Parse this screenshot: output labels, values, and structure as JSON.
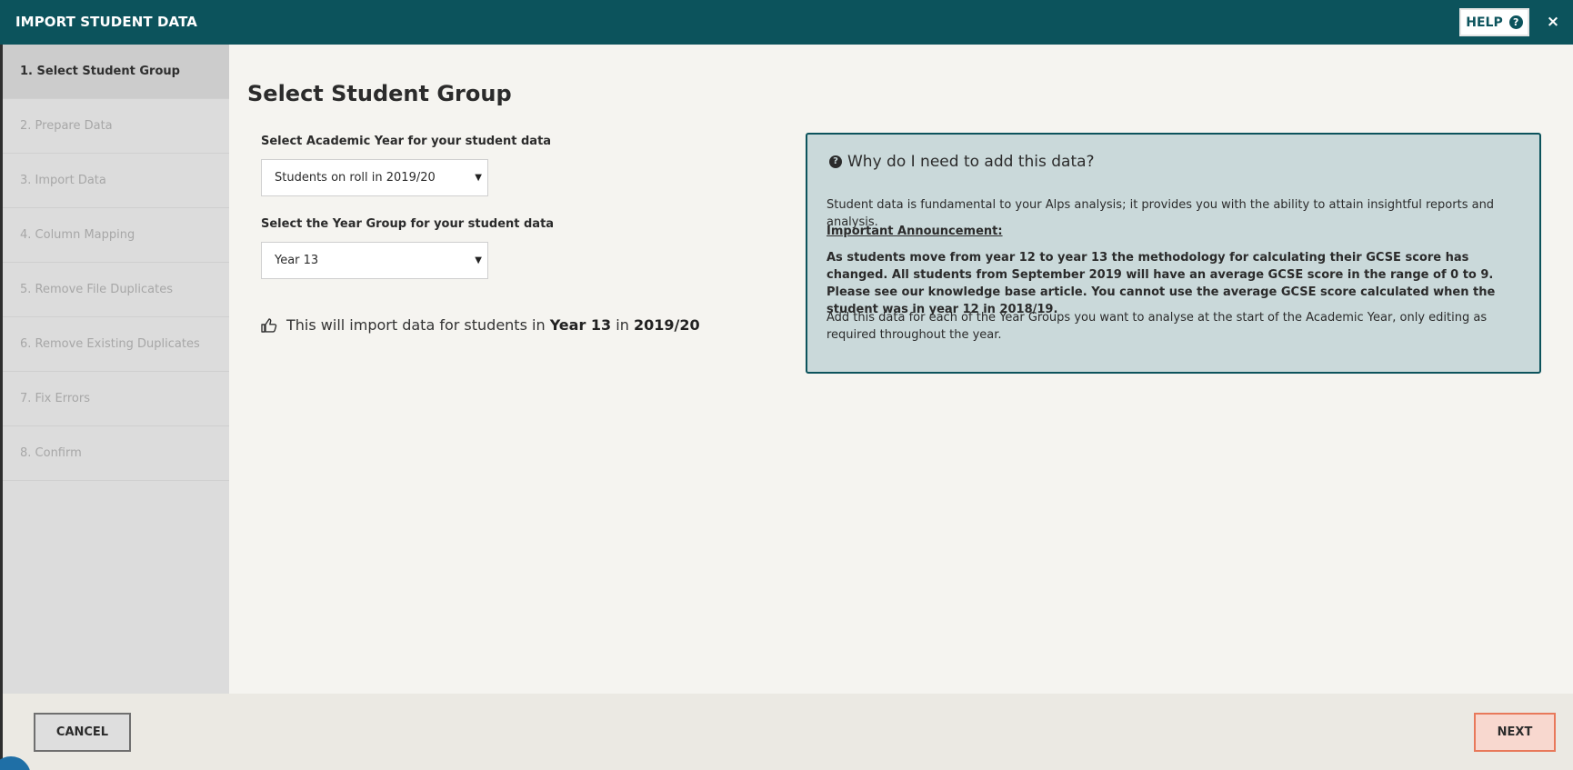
{
  "window": {
    "title": "IMPORT STUDENT DATA",
    "help_label": "HELP",
    "help_icon": "?",
    "close_icon": "×"
  },
  "sidebar": {
    "steps": [
      {
        "label": "1. Select Student Group",
        "active": true
      },
      {
        "label": "2. Prepare Data",
        "active": false
      },
      {
        "label": "3. Import Data",
        "active": false
      },
      {
        "label": "4. Column Mapping",
        "active": false
      },
      {
        "label": "5. Remove File Duplicates",
        "active": false
      },
      {
        "label": "6. Remove Existing Duplicates",
        "active": false
      },
      {
        "label": "7. Fix Errors",
        "active": false
      },
      {
        "label": "8. Confirm",
        "active": false
      }
    ]
  },
  "main": {
    "title": "Select Student Group",
    "academic_year": {
      "label": "Select Academic Year for your student data",
      "value": "Students on roll in 2019/20"
    },
    "year_group": {
      "label": "Select the Year Group for your student data",
      "value": "Year 13"
    },
    "import_message": {
      "prefix": "This will import data for students in",
      "year_group": "Year 13",
      "connector": "in",
      "academic_year": "2019/20"
    }
  },
  "info": {
    "heading": "Why do I need to add this data?",
    "intro": "Student data is fundamental to your Alps analysis; it provides you with the ability to attain insightful reports and analysis.",
    "announcement_title": "Important Announcement:",
    "announcement": "As students move from year 12 to year 13 the methodology for calculating their GCSE score has changed. All students from September 2019 will have an average GCSE score in the range of 0 to 9. Please see our knowledge base article. You cannot use the average GCSE score calculated when the student was in year 12 in 2018/19.",
    "outro": "Add this data for each of the Year Groups you want to analyse at the start of the Academic Year, only editing as required throughout the year."
  },
  "footer": {
    "cancel_label": "CANCEL",
    "next_label": "NEXT"
  },
  "colors": {
    "header": "#0c535c",
    "next_border": "#e8795b",
    "info_bg": "#cad9da"
  }
}
